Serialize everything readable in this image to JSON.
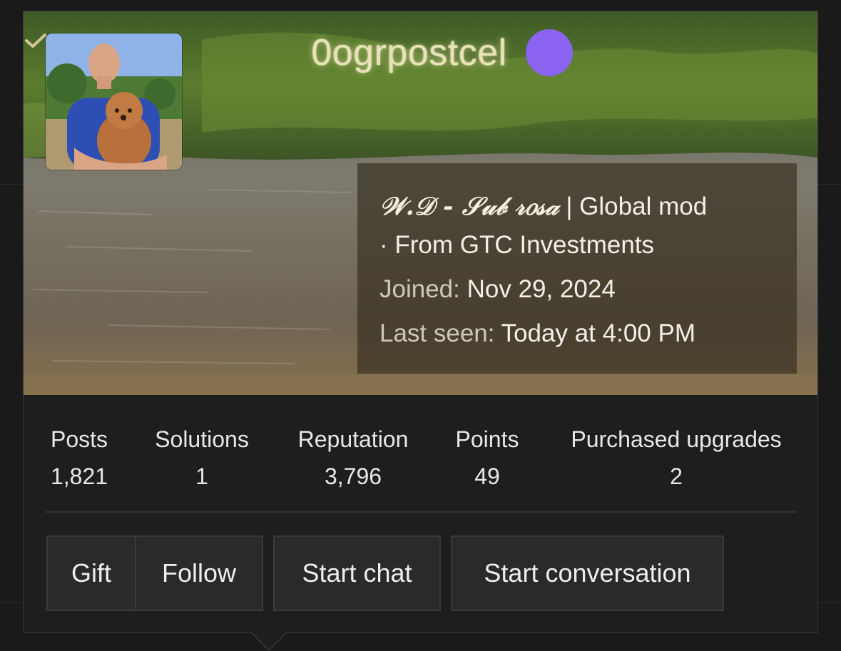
{
  "profile": {
    "username": "0ogrpostcel",
    "verified_icon": "verified-check-icon",
    "avatar_alt": "avatar-photo",
    "title_script": "𝒲.𝒟 - 𝒮𝓊𝒷 𝓇𝑜𝓈𝒶",
    "title_rest": " | Global mod",
    "affiliation": "· From GTC Investments",
    "joined_label": "Joined:",
    "joined_value": "Nov 29, 2024",
    "last_seen_label": "Last seen:",
    "last_seen_value": "Today at 4:00 PM"
  },
  "stats": [
    {
      "label": "Posts",
      "value": "1,821"
    },
    {
      "label": "Solutions",
      "value": "1"
    },
    {
      "label": "Reputation",
      "value": "3,796"
    },
    {
      "label": "Points",
      "value": "49"
    },
    {
      "label": "Purchased upgrades",
      "value": "2"
    }
  ],
  "actions": {
    "gift": "Gift",
    "follow": "Follow",
    "start_chat": "Start chat",
    "start_conversation": "Start conversation"
  },
  "colors": {
    "card_bg": "#1e1e1e",
    "verified_badge": "#8a64f0",
    "username_glow": "#e9e2b8",
    "button_bg": "#2a2a2a"
  }
}
